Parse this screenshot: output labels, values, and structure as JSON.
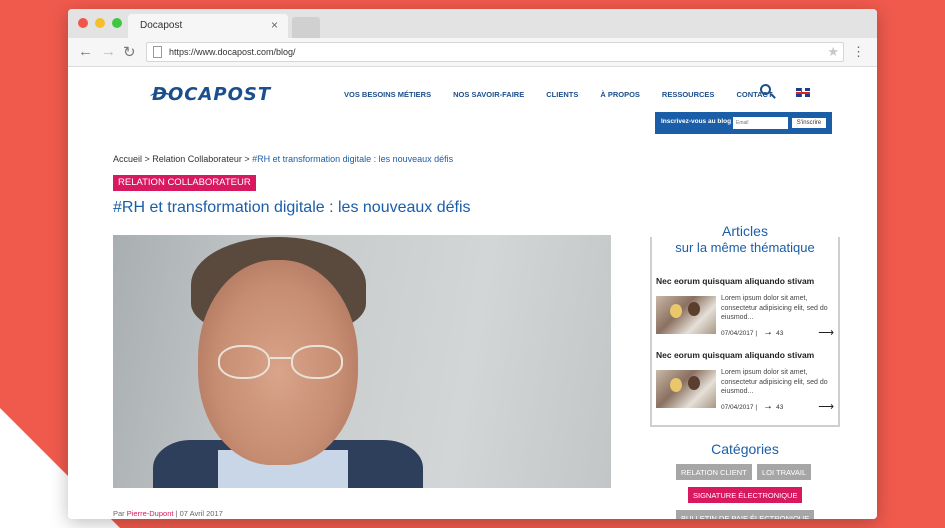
{
  "browser": {
    "tab_title": "Docapost",
    "tab_close": "×",
    "url": "https://www.docapost.com/blog/",
    "back": "←",
    "forward": "→",
    "reload": "↻",
    "star": "★",
    "menu": "⋮"
  },
  "site": {
    "logo": "DOCAPOST",
    "nav": [
      "VOS BESOINS MÉTIERS",
      "NOS SAVOIR-FAIRE",
      "CLIENTS",
      "À PROPOS",
      "RESSOURCES",
      "CONTACT"
    ],
    "newsletter": {
      "label": "Inscrivez-vous au blog",
      "placeholder": "Email",
      "button": "S'inscrire"
    }
  },
  "article": {
    "breadcrumb_prefix": "Accueil > Relation Collaborateur > ",
    "breadcrumb_current": "#RH et transformation digitale : les nouveaux défis",
    "category": "RELATION COLLABORATEUR",
    "title": "#RH et transformation digitale : les nouveaux défis",
    "byline_prefix": "Par ",
    "author": "Pierre-Dupont",
    "date": " | 07 Avril 2017"
  },
  "related": {
    "title_line1": "Articles",
    "title_line2": "sur la même thématique",
    "items": [
      {
        "title": "Nec eorum quisquam aliquando stivam",
        "excerpt": "Lorem ipsum dolor sit amet, consectetur adipisicing elit, sed do eiusmod...",
        "date": "07/04/2017",
        "sep": "|",
        "shares": "43"
      },
      {
        "title": "Nec eorum quisquam aliquando stivam",
        "excerpt": "Lorem ipsum dolor sit amet, consectetur adipisicing elit, sed do eiusmod...",
        "date": "07/04/2017",
        "sep": "|",
        "shares": "43"
      }
    ]
  },
  "categories": {
    "title": "Catégories",
    "tags": [
      "RELATION CLIENT",
      "LOI TRAVAIL",
      "SIGNATURE ÉLECTRONIQUE",
      "BULLETIN DE PAIE ÉLECTRONIQUE"
    ]
  },
  "colors": {
    "brand_blue": "#1b5ea8",
    "accent_pink": "#d8185f",
    "background": "#f05a4d"
  }
}
